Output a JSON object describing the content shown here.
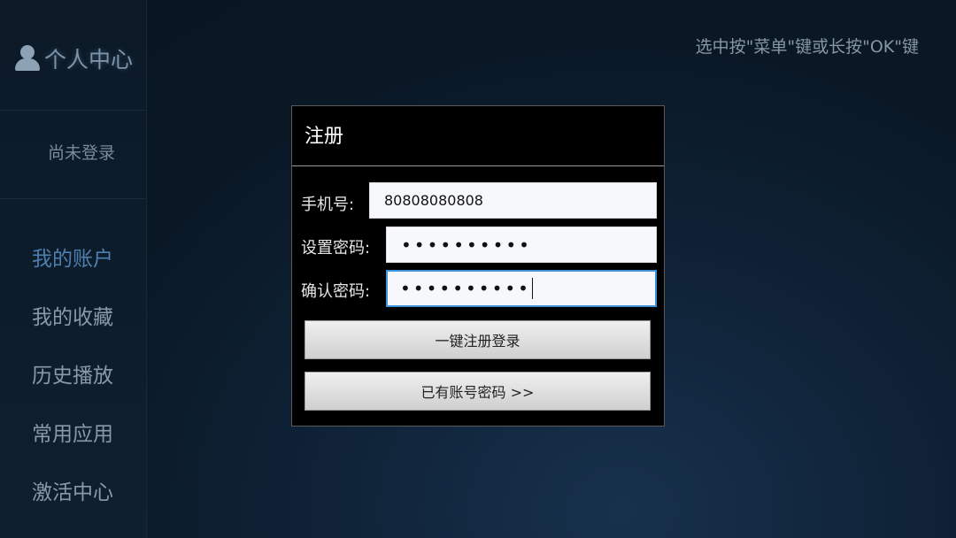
{
  "sidebar": {
    "profile_title": "个人中心",
    "login_status": "尚未登录",
    "items": [
      {
        "label": "我的账户",
        "active": true
      },
      {
        "label": "我的收藏",
        "active": false
      },
      {
        "label": "历史播放",
        "active": false
      },
      {
        "label": "常用应用",
        "active": false
      },
      {
        "label": "激活中心",
        "active": false
      }
    ]
  },
  "hint": "选中按\"菜单\"键或长按\"OK\"键",
  "dialog": {
    "title": "注册",
    "phone_label": "手机号:",
    "phone_value": "80808080808",
    "password_label": "设置密码:",
    "password_value": "••••••••••",
    "confirm_label": "确认密码:",
    "confirm_value": "••••••••••",
    "register_button": "一键注册登录",
    "have_account_button": "已有账号密码 >>"
  },
  "colors": {
    "active_nav": "#4f7fae",
    "focus_border": "#3f93d8"
  }
}
